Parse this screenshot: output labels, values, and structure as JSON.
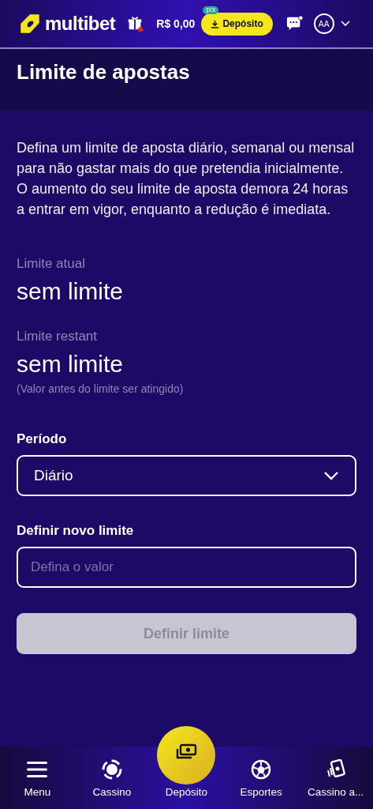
{
  "header": {
    "logo": "multibet",
    "balance": "R$ 0,00",
    "pix_badge": "pix",
    "deposit_button": "Depósito",
    "avatar": "AA",
    "gift_notification": true,
    "chat_notification": true
  },
  "page_title": "Limite de apostas",
  "description": "Defina um limite de aposta diário, semanal ou mensal para não gastar mais do que pretendia inicialmente. O aumento do seu limite de aposta demora 24 horas a entrar em vigor, enquanto a redução é imediata.",
  "current_limit": {
    "label": "Limite atual",
    "value": "sem limite"
  },
  "remaining_limit": {
    "label": "Limite restant",
    "value": "sem limite",
    "note": "(Valor antes do limite ser atingido)"
  },
  "period": {
    "label": "Período",
    "value": "Diário"
  },
  "new_limit": {
    "label": "Definir novo limite",
    "placeholder": "Defina o valor"
  },
  "submit": {
    "label": "Definir limite",
    "disabled": true
  },
  "bottom_nav": [
    {
      "label": "Menu",
      "kind": "tab"
    },
    {
      "label": "Cassino",
      "kind": "tab"
    },
    {
      "label": "Depósito",
      "kind": "featured"
    },
    {
      "label": "Esportes",
      "kind": "tab"
    },
    {
      "label": "Cassino a...",
      "kind": "tab"
    }
  ]
}
